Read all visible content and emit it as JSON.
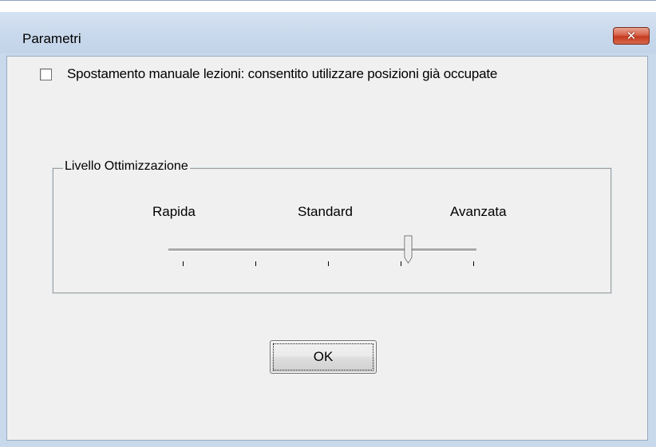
{
  "window": {
    "title": "Parametri",
    "close_symbol": "✕"
  },
  "options": {
    "manual_move_label": "Spostamento manuale lezioni: consentito utilizzare posizioni già occupate",
    "manual_move_checked": false
  },
  "optimization": {
    "group_label": "Livello Ottimizzazione",
    "labels": [
      "Rapida",
      "Standard",
      "Avanzata"
    ],
    "tick_count": 5,
    "selected_index": 3
  },
  "buttons": {
    "ok_label": "OK"
  },
  "icons": {
    "close": "close-icon",
    "slider_thumb": "slider-thumb-icon"
  },
  "colors": {
    "close_button": "#c5391f",
    "dialog_background": "#f0f0f0",
    "frame": "#c9d9ec"
  }
}
